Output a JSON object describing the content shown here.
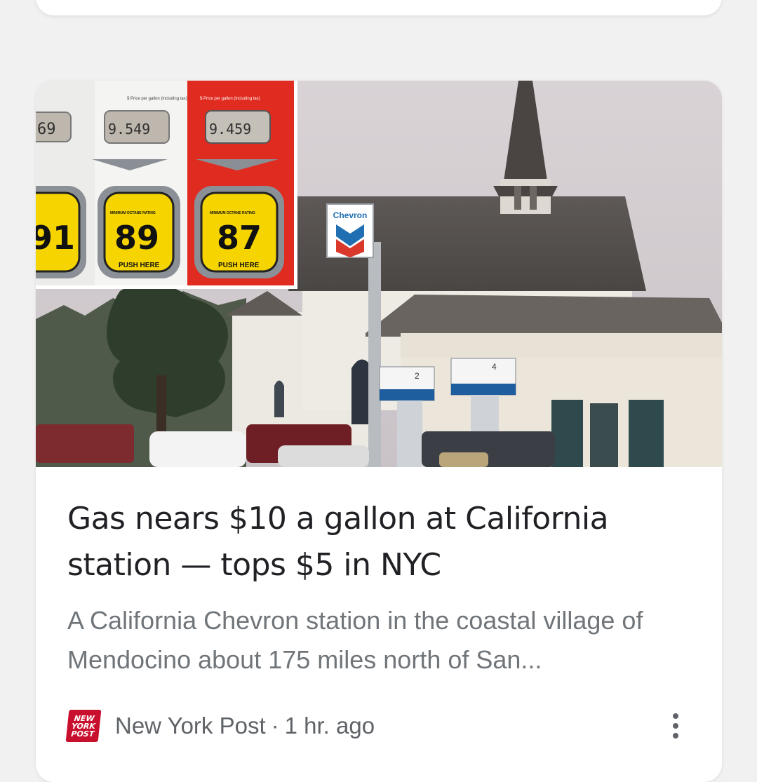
{
  "article": {
    "headline": "Gas nears $10 a gallon at California station — tops $5 in NYC",
    "snippet": "A California Chevron station in the coastal village of Mendocino about 175 miles north of San...",
    "source": "New York Post",
    "separator": "·",
    "time": "1 hr. ago",
    "source_logo_lines": [
      "NEW",
      "YORK",
      "POST"
    ],
    "menu_icon": "more-vert-icon"
  },
  "image": {
    "pump_prices": [
      "69",
      "9.549",
      "9.459"
    ],
    "octane_ratings": [
      "91",
      "89",
      "87"
    ],
    "price_caption": "$ Price per gallon (including tax)",
    "rating_caption": "MINIMUM OCTANE RATING",
    "push_label": "PUSH HERE",
    "station_brand": "Chevron",
    "pump_numbers": [
      "2",
      "4"
    ]
  },
  "colors": {
    "headline": "#202124",
    "snippet": "#70757a",
    "meta": "#5f6368",
    "logo_red": "#c8102e",
    "pump_red": "#e02b20",
    "octane_yellow": "#f5d400"
  }
}
